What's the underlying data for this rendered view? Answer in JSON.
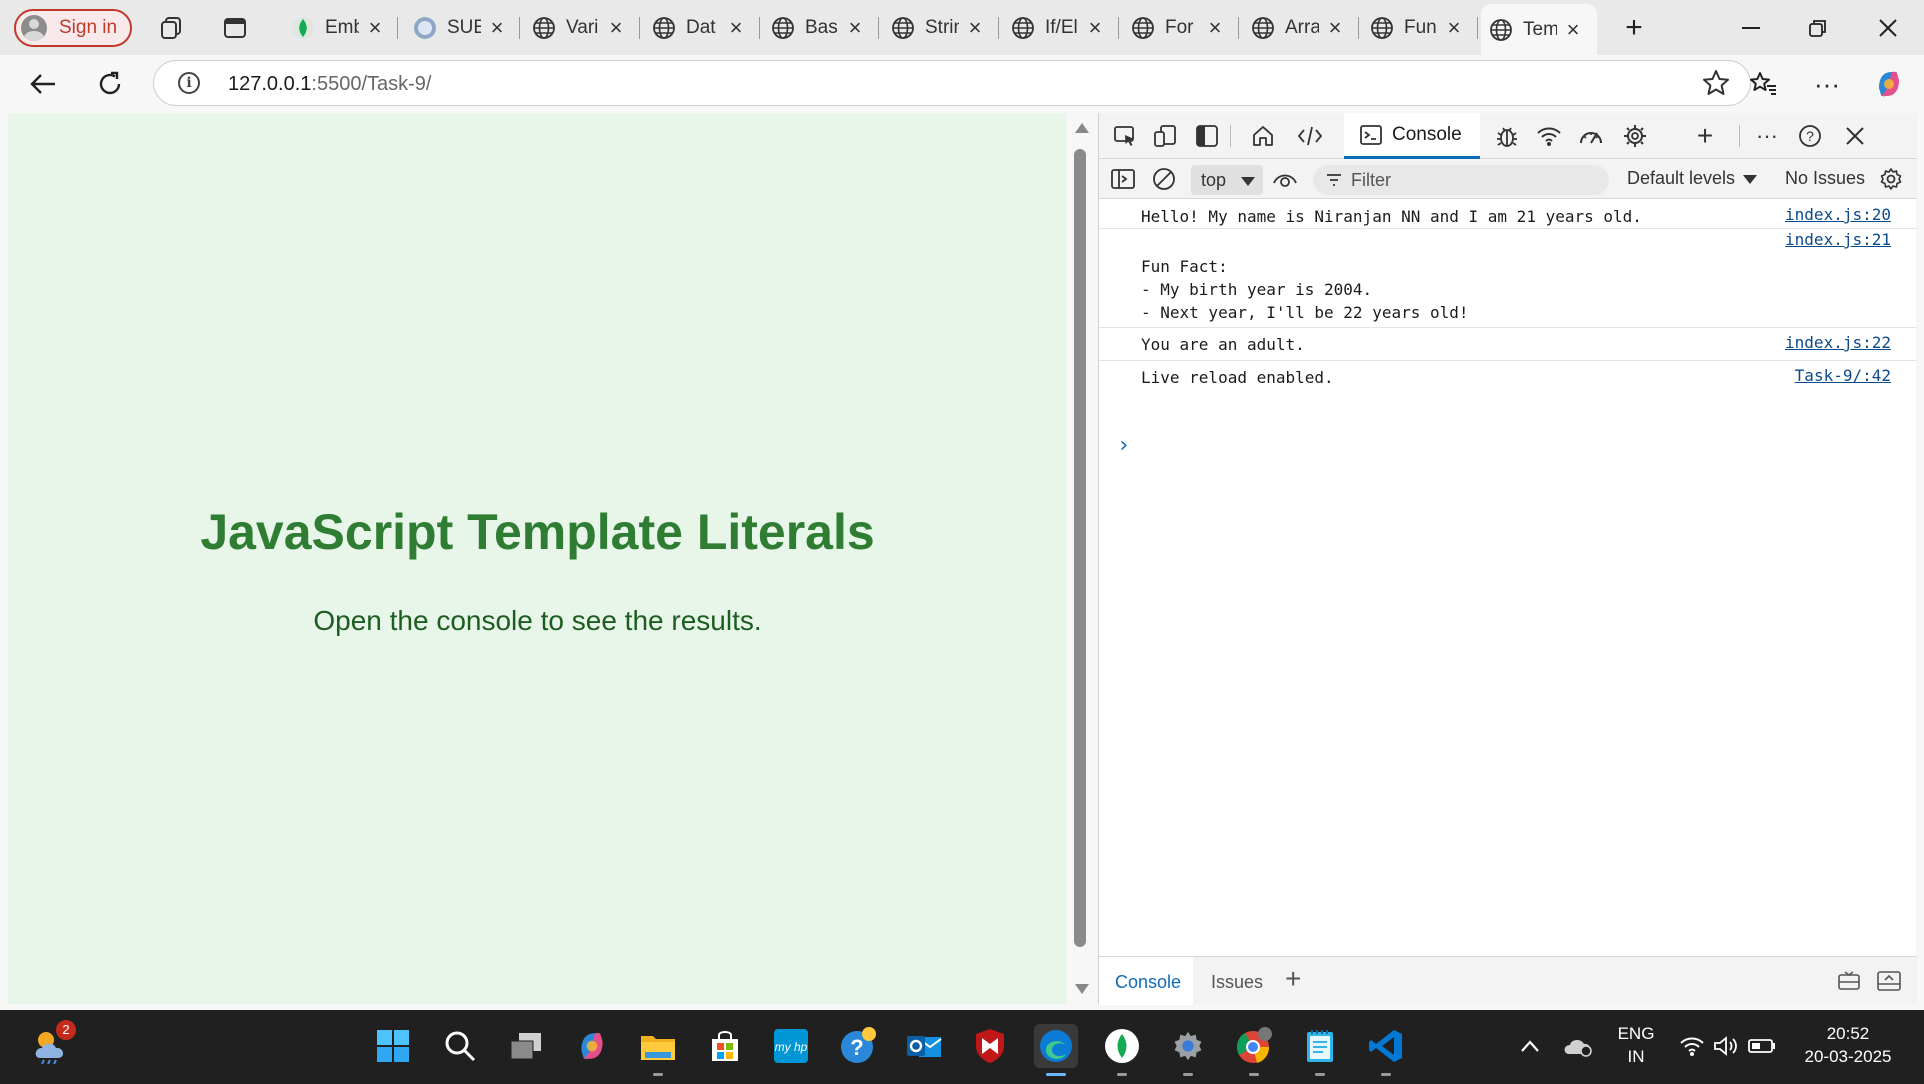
{
  "browser": {
    "signin_label": "Sign in",
    "tabs": [
      {
        "label": "Emb",
        "icon": "mongodb-leaf-icon"
      },
      {
        "label": "SUE",
        "icon": "profile-circle-icon"
      },
      {
        "label": "Vari",
        "icon": "globe-icon"
      },
      {
        "label": "Dat",
        "icon": "globe-icon"
      },
      {
        "label": "Basi",
        "icon": "globe-icon"
      },
      {
        "label": "Strin",
        "icon": "globe-icon"
      },
      {
        "label": "If/El",
        "icon": "globe-icon"
      },
      {
        "label": "For",
        "icon": "globe-icon"
      },
      {
        "label": "Arra",
        "icon": "globe-icon"
      },
      {
        "label": "Fun",
        "icon": "globe-icon"
      },
      {
        "label": "Tem",
        "icon": "globe-icon",
        "active": true
      }
    ],
    "address": {
      "host": "127.0.0.1",
      "path": ":5500/Task-9/"
    }
  },
  "page": {
    "title": "JavaScript Template Literals",
    "subtitle": "Open the console to see the results.",
    "background": "#e8f5e9",
    "title_color": "#2e7d32"
  },
  "devtools": {
    "active_tab": "Console",
    "context": "top",
    "filter_placeholder": "Filter",
    "levels_label": "Default levels",
    "issues_label": "No Issues",
    "messages": [
      {
        "text": "Hello! My name is Niranjan NN and I am 21 years old.",
        "source": "index.js:20"
      },
      {
        "text": "\nFun Fact:\n- My birth year is 2004.\n- Next year, I'll be 22 years old!",
        "source": "index.js:21"
      },
      {
        "text": "You are an adult.",
        "source": "index.js:22"
      },
      {
        "text": "Live reload enabled.",
        "source": "Task-9/:42"
      }
    ],
    "drawer_tabs": [
      "Console",
      "Issues"
    ],
    "accent": "#0f6cbd"
  },
  "taskbar": {
    "weather_badge": "2",
    "language": "ENG",
    "region": "IN",
    "time": "20:52",
    "date": "20-03-2025"
  }
}
